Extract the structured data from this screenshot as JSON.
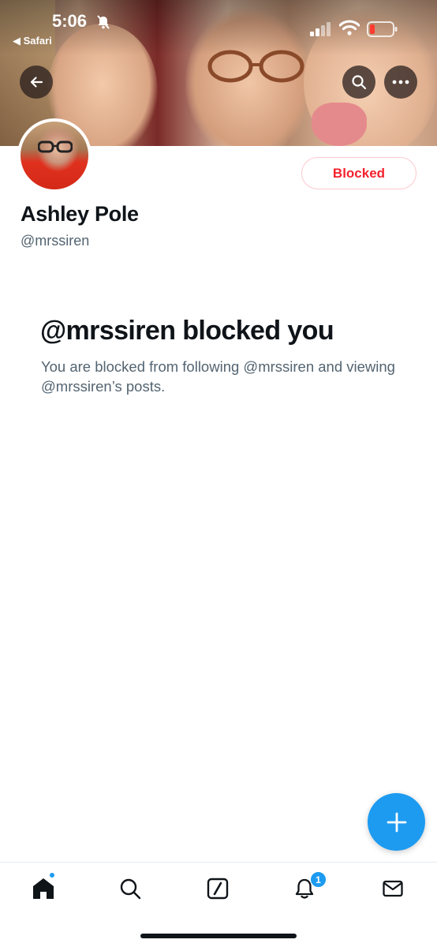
{
  "status_bar": {
    "time": "5:06",
    "back_app": "Safari"
  },
  "profile": {
    "display_name": "Ashley Pole",
    "handle": "@mrssiren",
    "block_button_label": "Blocked"
  },
  "blocked_notice": {
    "title": "@mrssiren blocked you",
    "description": "You are blocked from following @mrssiren and viewing @mrssiren’s posts."
  },
  "tabbar": {
    "notifications_count": "1"
  },
  "colors": {
    "accent": "#1d9bf0",
    "blocked_red": "#f4212e",
    "secondary_text": "#536471"
  },
  "icons": [
    "back-arrow-icon",
    "search-icon",
    "more-icon",
    "compose-plus-icon",
    "home-icon",
    "explore-search-icon",
    "grok-icon",
    "bell-icon",
    "mail-icon"
  ]
}
